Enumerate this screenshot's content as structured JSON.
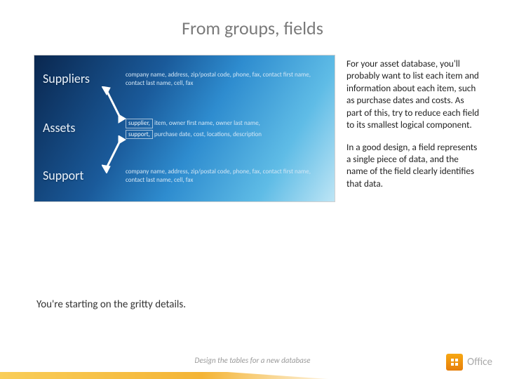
{
  "title": "From groups, fields",
  "diagram": {
    "suppliers": {
      "label": "Suppliers",
      "fields": "company name, address, zip/postal code, phone, fax, contact first name, contact last name, cell, fax"
    },
    "assets": {
      "label": "Assets",
      "supplier_box": "supplier,",
      "support_box": "support,",
      "line1_rest": "item, owner first name, owner last name,",
      "line2_rest": "purchase date, cost, locations, description"
    },
    "support": {
      "label": "Support",
      "fields": "company name, address, zip/postal code, phone, fax, contact first name, contact last name, cell, fax"
    }
  },
  "body": {
    "p1": "For your asset database, you'll probably want to list each item and information about each item, such as purchase dates and costs. As part of this, try to reduce each field to its smallest logical component.",
    "p2": "In a good design, a field represents a single piece of data, and the name of the field clearly identifies that data."
  },
  "sub": "You're starting on the gritty details.",
  "footer_text": "Design the tables for a new database",
  "brand": "Office"
}
